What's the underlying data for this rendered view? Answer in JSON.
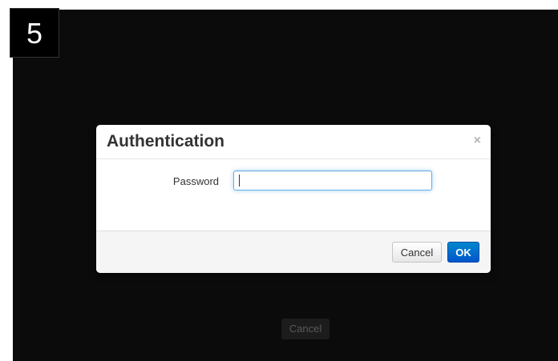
{
  "step": {
    "number": "5"
  },
  "background": {
    "cancel_label": "Cancel"
  },
  "dialog": {
    "title": "Authentication",
    "close_glyph": "×",
    "password_label": "Password",
    "password_value": "",
    "cancel_label": "Cancel",
    "ok_label": "OK"
  },
  "colors": {
    "screen_bg": "#0b0b0b",
    "ok_button": "#0069cc",
    "focus_ring": "#66afe9"
  },
  "icons": {
    "close": "close-icon"
  }
}
